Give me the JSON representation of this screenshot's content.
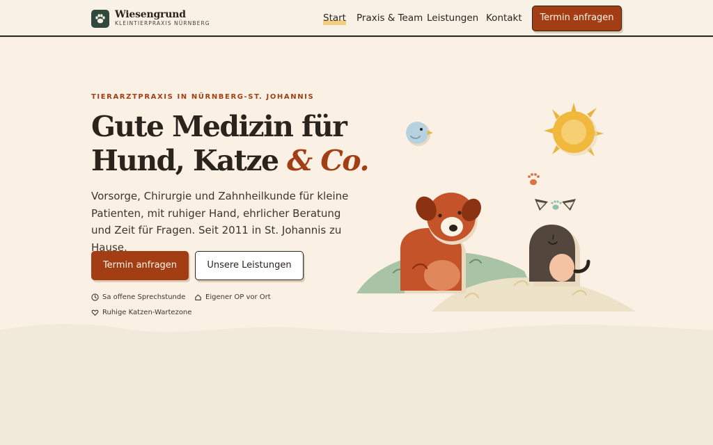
{
  "brand": {
    "name": "Wiesengrund",
    "subtitle": "KLEINTIERPRAXIS NÜRNBERG",
    "logo_icon": "paw-icon"
  },
  "nav": {
    "items": [
      {
        "label": "Start",
        "active": true
      },
      {
        "label": "Praxis & Team",
        "active": false
      },
      {
        "label": "Leistungen",
        "active": false
      },
      {
        "label": "Kontakt",
        "active": false
      }
    ],
    "cta_label": "Termin anfragen"
  },
  "hero": {
    "eyebrow": "TIERARZTPRAXIS IN NÜRNBERG-ST. JOHANNIS",
    "title_line1": "Gute Medizin für",
    "title_line2": "Hund, Katze",
    "title_accent": "& Co.",
    "lead": "Vorsorge, Chirurgie und Zahnheilkunde für kleine Patienten, mit ruhiger Hand, ehrlicher Beratung und Zeit für Fragen. Seit 2011 in St. Johannis zu Hause.",
    "primary_button": "Termin anfragen",
    "secondary_button": "Unsere Leistungen",
    "features": [
      {
        "icon": "clock-icon",
        "label": "Sa offene Sprechstunde"
      },
      {
        "icon": "home-icon",
        "label": "Eigener OP vor Ort"
      },
      {
        "icon": "heart-icon",
        "label": "Ruhige Katzen-Wartezone"
      }
    ]
  },
  "colors": {
    "accent": "#a33d14",
    "ink": "#2b241d",
    "hero_bg": "#faf1e4",
    "lower_bg": "#f1e9d9",
    "logo_green": "#2f4a3c",
    "highlight": "#f2cf7e"
  },
  "illustration": {
    "elements": [
      "sun-icon",
      "bird-icon",
      "paw-icon",
      "dog-illustration",
      "cat-illustration",
      "hills"
    ]
  }
}
